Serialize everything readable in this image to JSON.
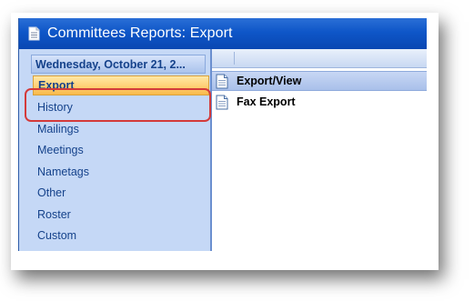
{
  "window": {
    "title": "Committees Reports: Export",
    "title_icon": "document-icon"
  },
  "sidebar": {
    "date_header": "Wednesday, October 21, 2...",
    "items": [
      {
        "label": "Export",
        "active": true
      },
      {
        "label": "History"
      },
      {
        "label": "Mailings"
      },
      {
        "label": "Meetings"
      },
      {
        "label": "Nametags"
      },
      {
        "label": "Other"
      },
      {
        "label": "Roster"
      },
      {
        "label": "Custom"
      }
    ]
  },
  "main": {
    "rows": [
      {
        "label": "Export/View",
        "icon": "document-icon",
        "selected": true
      },
      {
        "label": "Fax Export",
        "icon": "document-icon"
      }
    ]
  },
  "colors": {
    "titlebar": "#0e56c8",
    "sidebar_bg": "#c5d8f6",
    "nav_text": "#15428b",
    "active_item": "#ffd27a",
    "annotation": "#d43a3a"
  }
}
